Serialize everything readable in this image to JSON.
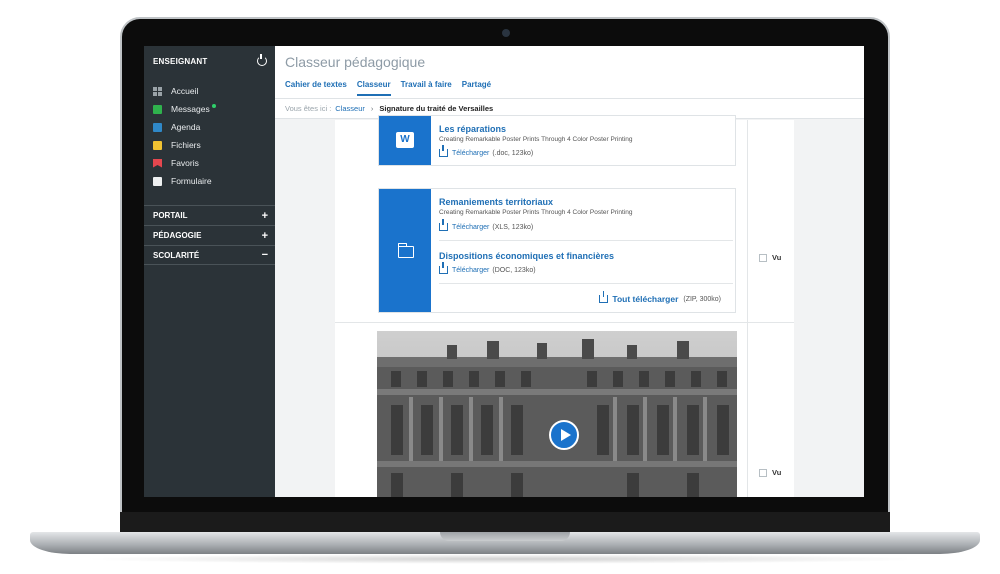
{
  "sidebar": {
    "title": "ENSEIGNANT",
    "items": [
      {
        "label": "Accueil",
        "icon": "home-grid-icon"
      },
      {
        "label": "Messages",
        "icon": "mail-icon"
      },
      {
        "label": "Agenda",
        "icon": "calendar-icon"
      },
      {
        "label": "Fichiers",
        "icon": "folder-icon"
      },
      {
        "label": "Favoris",
        "icon": "bookmark-icon"
      },
      {
        "label": "Formulaire",
        "icon": "form-icon"
      }
    ],
    "sections": [
      {
        "label": "PORTAIL",
        "toggle": "+"
      },
      {
        "label": "PÉDAGOGIE",
        "toggle": "+"
      },
      {
        "label": "SCOLARITÉ",
        "toggle": "−"
      }
    ]
  },
  "header": {
    "title": "Classeur pédagogique",
    "tabs": [
      "Cahier de textes",
      "Classeur",
      "Travail à faire",
      "Partagé"
    ],
    "active_tab": "Classeur"
  },
  "breadcrumb": {
    "prefix": "Vous êtes ici :",
    "link": "Classeur",
    "separator": "›",
    "current": "Signature du traité de Versailles"
  },
  "docs": {
    "card1": {
      "title": "Les réparations",
      "subtitle": "Creating Remarkable Poster Prints Through 4 Color Poster Printing",
      "download_label": "Télécharger",
      "download_meta": "(.doc, 123ko)"
    },
    "card2": {
      "item1": {
        "title": "Remaniements territoriaux",
        "subtitle": "Creating Remarkable Poster Prints Through 4 Color Poster Printing",
        "download_label": "Télécharger",
        "download_meta": "(XLS, 123ko)"
      },
      "item2": {
        "title": "Dispositions économiques et financières",
        "download_label": "Télécharger",
        "download_meta": "(DOC, 123ko)"
      },
      "download_all_label": "Tout télécharger",
      "download_all_meta": "(ZIP, 300ko)"
    }
  },
  "vu": {
    "label1": "Vu",
    "label2": "Vu"
  },
  "colors": {
    "accent": "#1a73cc",
    "link": "#1f6fb5",
    "sidebar": "#2b3338",
    "notification": "#2fd06a"
  }
}
